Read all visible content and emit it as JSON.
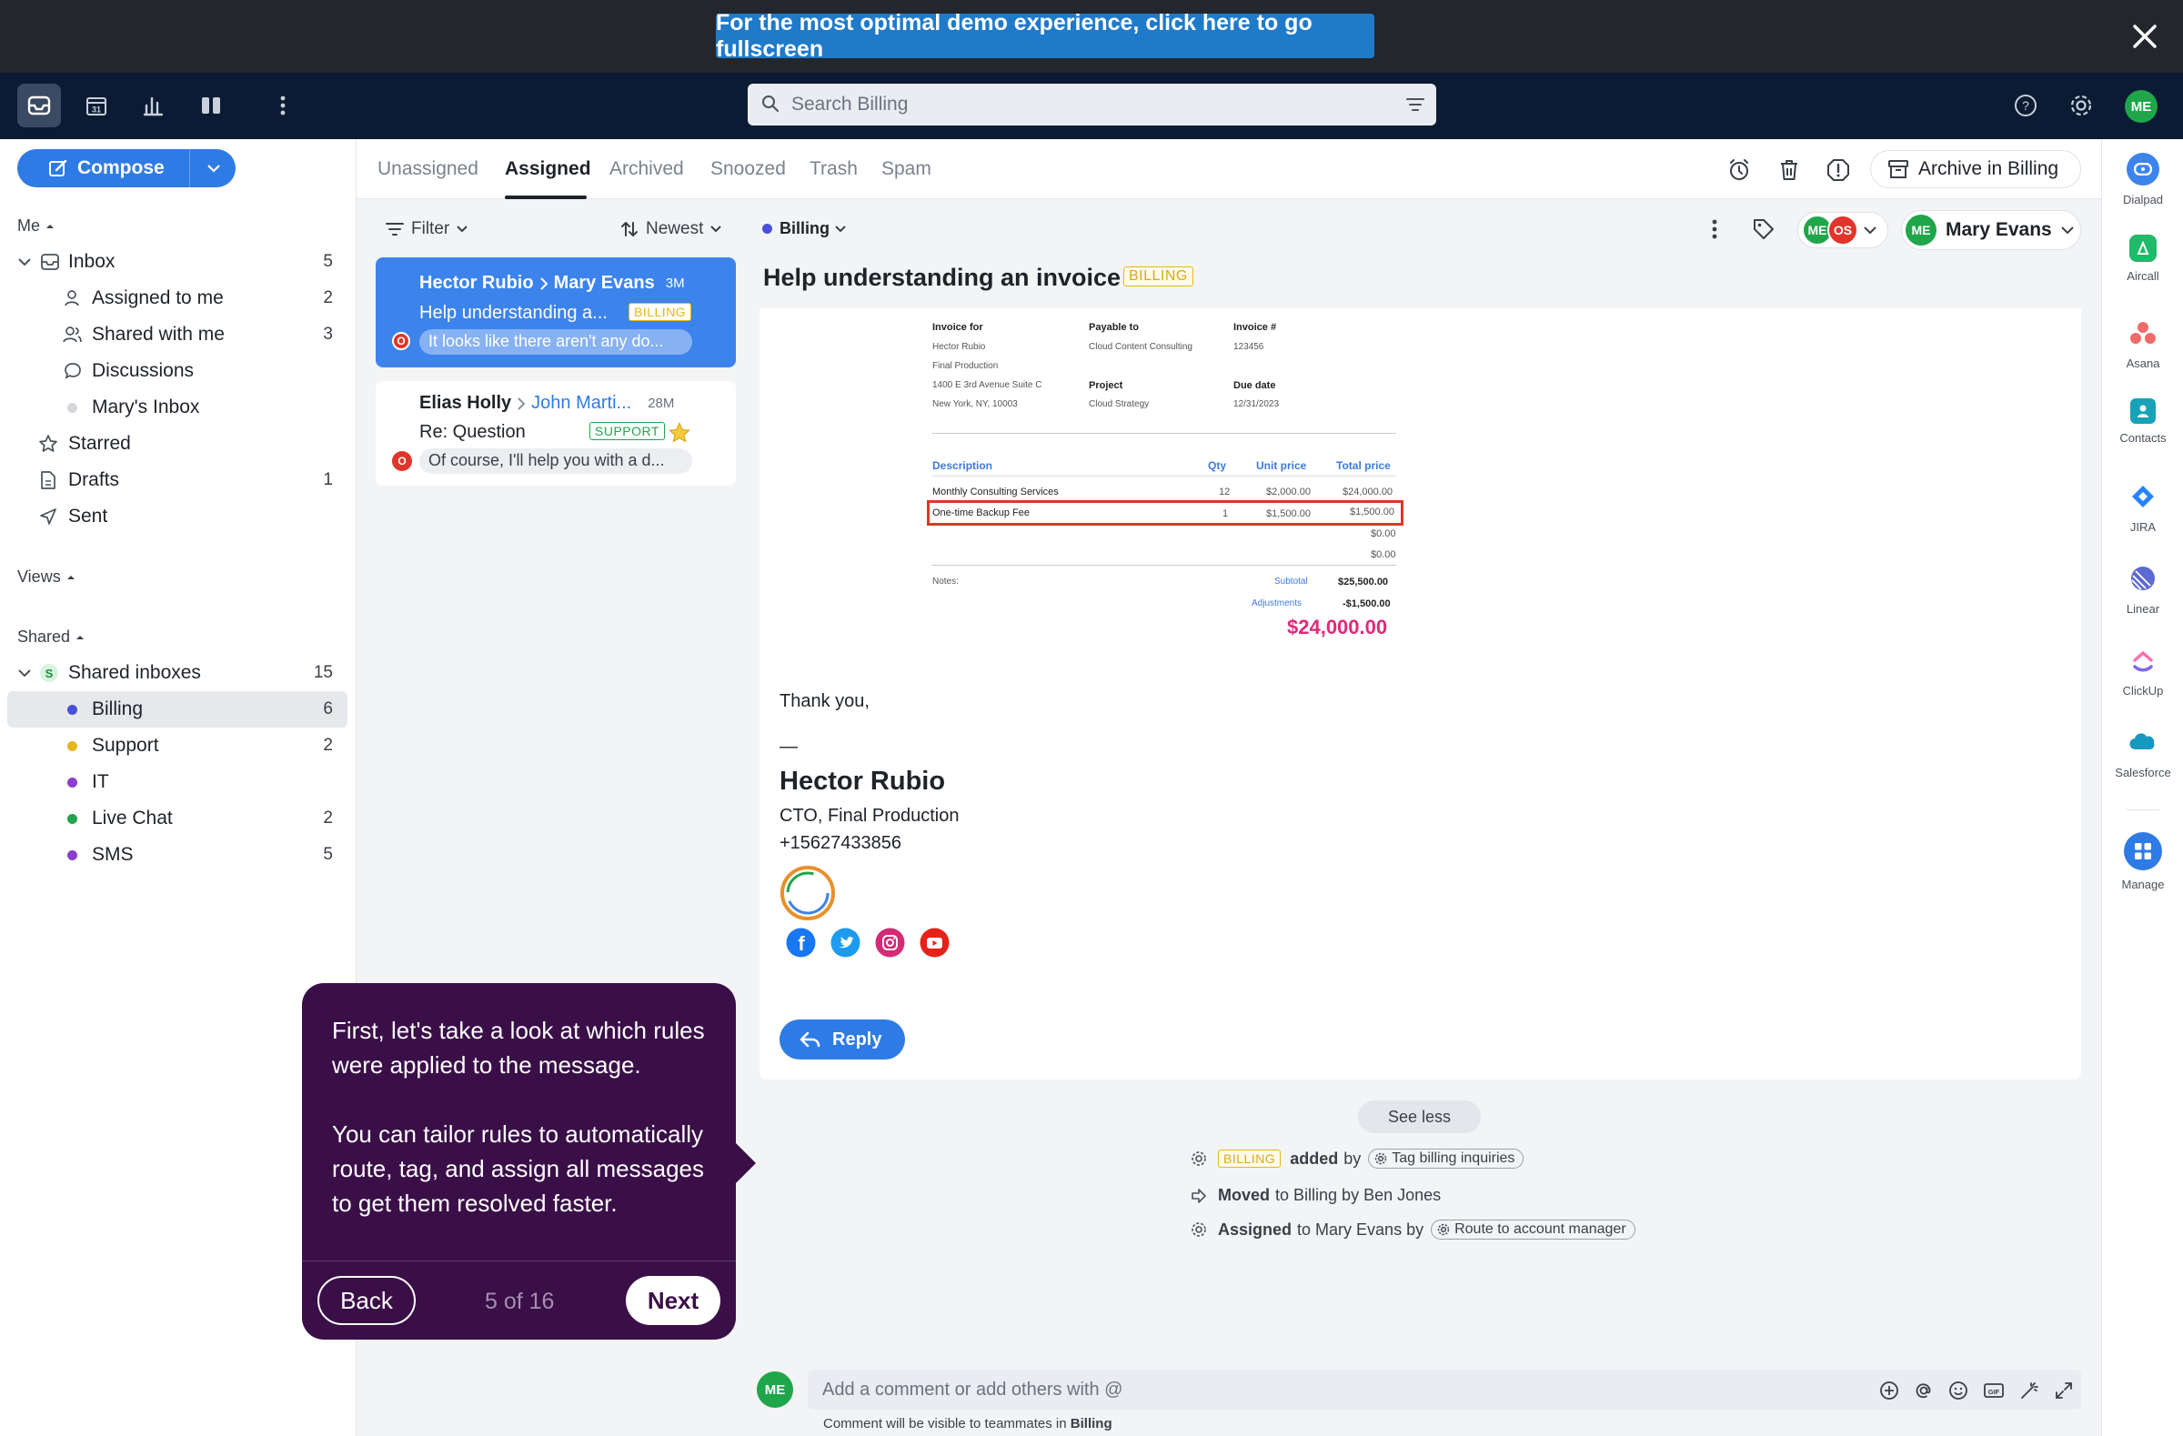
{
  "demo": {
    "banner": "For the most optimal demo experience, click here to go fullscreen"
  },
  "header": {
    "search_placeholder": "Search Billing",
    "user_initials": "ME"
  },
  "sidebar": {
    "compose": "Compose",
    "me_label": "Me",
    "items": [
      {
        "label": "Inbox",
        "count": "5"
      },
      {
        "label": "Assigned to me",
        "count": "2"
      },
      {
        "label": "Shared with me",
        "count": "3"
      },
      {
        "label": "Discussions",
        "count": ""
      },
      {
        "label": "Mary's Inbox",
        "count": ""
      },
      {
        "label": "Starred",
        "count": ""
      },
      {
        "label": "Drafts",
        "count": "1"
      },
      {
        "label": "Sent",
        "count": ""
      }
    ],
    "views_label": "Views",
    "shared_label": "Shared",
    "shared_inboxes": {
      "label": "Shared inboxes",
      "count": "15",
      "badge": "S"
    },
    "inboxes": [
      {
        "label": "Billing",
        "count": "6",
        "color": "#4a4fd9"
      },
      {
        "label": "Support",
        "count": "2",
        "color": "#e4b622"
      },
      {
        "label": "IT",
        "count": "",
        "color": "#8a3fd1"
      },
      {
        "label": "Live Chat",
        "count": "2",
        "color": "#1fa64a"
      },
      {
        "label": "SMS",
        "count": "5",
        "color": "#8a3fd1"
      }
    ]
  },
  "tabs": [
    "Unassigned",
    "Assigned",
    "Archived",
    "Snoozed",
    "Trash",
    "Spam"
  ],
  "toolbar": {
    "archive": "Archive in Billing",
    "filter": "Filter",
    "sort": "Newest",
    "inbox": "Billing",
    "assignee": "Mary Evans",
    "assignee_initials": "ME",
    "avatar2": "OS"
  },
  "conversations": [
    {
      "from": "Hector Rubio",
      "to": "Mary Evans",
      "time": "3M",
      "subject": "Help understanding a...",
      "tag": "BILLING",
      "preview": "It looks like there aren't any do...",
      "badge": "O"
    },
    {
      "from": "Elias Holly",
      "to": "John Marti...",
      "time": "28M",
      "subject": "Re: Question",
      "tag": "SUPPORT",
      "preview": "Of course, I'll help you with a d...",
      "badge": "O"
    }
  ],
  "message": {
    "subject": "Help understanding an invoice",
    "tag": "BILLING",
    "invoice": {
      "invoice_for_label": "Invoice for",
      "invoice_for": [
        "Hector Rubio",
        "Final Production",
        "1400 E 3rd Avenue Suite C",
        "New York, NY, 10003"
      ],
      "payable_label": "Payable to",
      "payable": "Cloud Content Consulting",
      "project_label": "Project",
      "project": "Cloud Strategy",
      "num_label": "Invoice #",
      "num": "123456",
      "due_label": "Due date",
      "due": "12/31/2023",
      "headers": [
        "Description",
        "Qty",
        "Unit price",
        "Total price"
      ],
      "rows": [
        [
          "Monthly Consulting Services",
          "12",
          "$2,000.00",
          "$24,000.00"
        ],
        [
          "One-time Backup Fee",
          "1",
          "$1,500.00",
          "$1,500.00"
        ],
        [
          "",
          "",
          "",
          "$0.00"
        ],
        [
          "",
          "",
          "",
          "$0.00"
        ]
      ],
      "notes": "Notes:",
      "subtotal_label": "Subtotal",
      "subtotal": "$25,500.00",
      "adjust_label": "Adjustments",
      "adjust": "-$1,500.00",
      "total": "$24,000.00"
    },
    "thanks": "Thank you,",
    "dash": "—",
    "sig_name": "Hector Rubio",
    "sig_title": "CTO, Final Production",
    "sig_phone": "+15627433856",
    "reply": "Reply"
  },
  "activity": {
    "see_less": "See less",
    "lines": [
      {
        "tag": "BILLING",
        "bold": "added",
        "mid": "by",
        "chip": "Tag billing inquiries"
      },
      {
        "bold": "Moved",
        "text": "to Billing by Ben Jones"
      },
      {
        "bold": "Assigned",
        "text": "to Mary Evans by",
        "chip": "Route to account manager"
      }
    ]
  },
  "tour": {
    "p1": "First, let's take a look at which rules were applied to the message.",
    "p2": "You can tailor rules to automatically route, tag, and assign all messages to get them resolved faster.",
    "back": "Back",
    "progress": "5 of 16",
    "next": "Next"
  },
  "comment": {
    "placeholder": "Add a comment or add others with @",
    "note_prefix": "Comment will be visible to teammates in",
    "note_inbox": "Billing",
    "initials": "ME"
  },
  "rail": [
    "Dialpad",
    "Aircall",
    "Asana",
    "Contacts",
    "JIRA",
    "Linear",
    "ClickUp",
    "Salesforce",
    "Manage"
  ]
}
